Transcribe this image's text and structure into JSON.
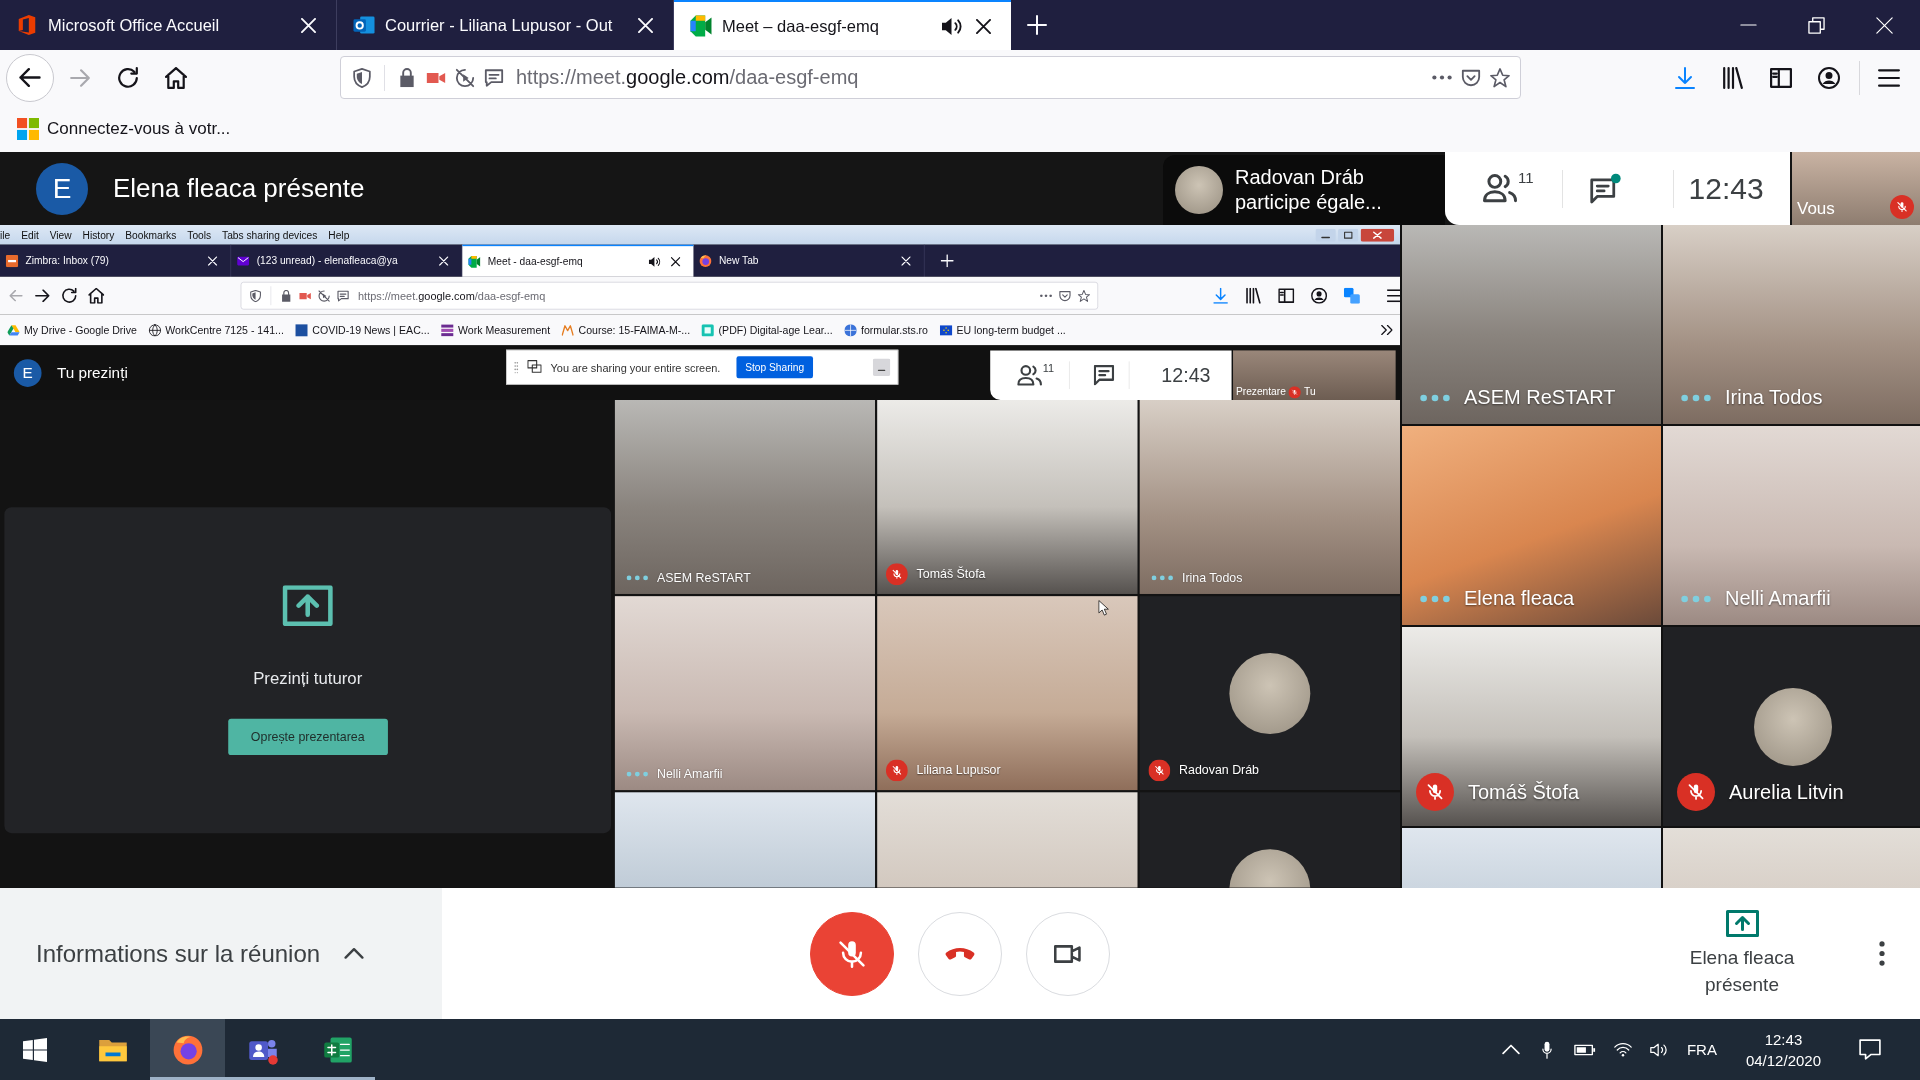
{
  "browser": {
    "tabs": [
      {
        "title": "Microsoft Office Accueil",
        "selected": false,
        "playing_audio": false
      },
      {
        "title": "Courrier - Liliana Lupusor - Out",
        "selected": false,
        "playing_audio": false
      },
      {
        "title": "Meet – daa-esgf-emq",
        "selected": true,
        "playing_audio": true
      }
    ],
    "back_disabled": false,
    "forward_disabled": true,
    "url": {
      "start": "https://meet.",
      "domain": "google.com",
      "end": "/daa-esgf-emq"
    },
    "bookmarks": [
      {
        "label": "Connectez-vous à votr..."
      }
    ]
  },
  "meet": {
    "presenter": {
      "initial": "E",
      "title": "Elena fleaca présente"
    },
    "notification": {
      "name": "Radovan Dráb",
      "message": "participe égale..."
    },
    "people_count": "11",
    "chat_unread": true,
    "time": "12:43",
    "self_view": {
      "label": "Vous",
      "muted": true
    },
    "shared_screen": {
      "menu": [
        "ile",
        "Edit",
        "View",
        "History",
        "Bookmarks",
        "Tools",
        "Tabs sharing devices",
        "Help"
      ],
      "browser": {
        "tabs": [
          {
            "title": "Zimbra: Inbox (79)",
            "selected": false,
            "playing_audio": false
          },
          {
            "title": "(123 unread) - elenafleaca@ya",
            "selected": false,
            "playing_audio": false
          },
          {
            "title": "Meet - daa-esgf-emq",
            "selected": true,
            "playing_audio": true
          },
          {
            "title": "New Tab",
            "selected": false,
            "playing_audio": false
          }
        ],
        "back_disabled": true,
        "forward_disabled": false,
        "url": {
          "start": "https://meet.",
          "domain": "google.com",
          "end": "/daa-esgf-emq"
        },
        "bookmarks": [
          {
            "label": "My Drive - Google Drive"
          },
          {
            "label": "WorkCentre 7125 - 141..."
          },
          {
            "label": "COVID-19 News | EAC..."
          },
          {
            "label": "Work Measurement"
          },
          {
            "label": "Course: 15-FAIMA-M-..."
          },
          {
            "label": "(PDF) Digital-age Lear..."
          },
          {
            "label": "formular.sts.ro"
          },
          {
            "label": "EU long-term budget ..."
          }
        ]
      },
      "meet": {
        "presenter": {
          "initial": "E",
          "title": "Tu prezinți"
        },
        "share_notice": {
          "text": "You are sharing your entire screen.",
          "button": "Stop Sharing"
        },
        "people_count": "11",
        "chat_unread": false,
        "time": "12:43",
        "self_view": {
          "label": "Prezentare",
          "name": "Tu",
          "muted": true
        },
        "present_panel": {
          "title": "Prezinți tuturor",
          "button": "Oprește prezentarea"
        },
        "tiles": [
          {
            "kind": "video",
            "name": "ASEM ReSTART",
            "muted": false
          },
          {
            "kind": "video",
            "name": "Tomáš Štofa",
            "muted": true
          },
          {
            "kind": "video",
            "name": "Irina Todos",
            "muted": false
          },
          {
            "kind": "video",
            "name": "Nelli Amarfii",
            "muted": false
          },
          {
            "kind": "video",
            "name": "Liliana Lupusor",
            "muted": true
          },
          {
            "kind": "avatar",
            "name": "Radovan Dráb",
            "muted": true
          },
          {
            "kind": "video"
          },
          {
            "kind": "video"
          },
          {
            "kind": "avatar"
          }
        ]
      }
    },
    "tiles": [
      {
        "kind": "video",
        "name": "ASEM ReSTART",
        "muted": false
      },
      {
        "kind": "video",
        "name": "Irina Todos",
        "muted": false
      },
      {
        "kind": "video",
        "name": "Elena fleaca",
        "muted": false
      },
      {
        "kind": "video",
        "name": "Nelli Amarfii",
        "muted": false
      },
      {
        "kind": "video",
        "name": "Tomáš Štofa",
        "muted": true
      },
      {
        "kind": "avatar",
        "name": "Aurelia Litvin",
        "muted": true
      },
      {
        "kind": "video"
      },
      {
        "kind": "video"
      }
    ],
    "controls": {
      "info_label": "Informations sur la réunion",
      "mic_muted": true,
      "camera_on": true,
      "present_label": "Elena fleaca présente"
    }
  },
  "taskbar": {
    "apps": [
      {
        "kind": "folder",
        "selected": false,
        "running": false,
        "notification": false
      },
      {
        "kind": "browser",
        "selected": true,
        "running": true,
        "notification": false
      },
      {
        "kind": "meeting",
        "selected": false,
        "running": true,
        "notification": true
      },
      {
        "kind": "spreadsheet",
        "selected": false,
        "running": true,
        "notification": false
      }
    ],
    "language": "FRA",
    "time": "12:43",
    "date": "04/12/2020"
  }
}
